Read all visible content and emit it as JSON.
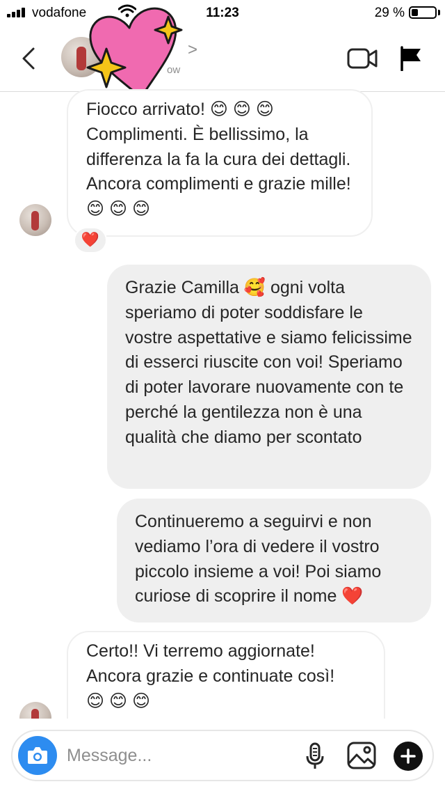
{
  "status_bar": {
    "carrier": "vodafone",
    "time": "11:23",
    "battery_percent": "29 %",
    "battery_level": 0.29
  },
  "header": {
    "name_arrow": ">",
    "subtitle": "ow"
  },
  "messages": [
    {
      "direction": "incoming",
      "text": "Fiocco arrivato! 😊 😊 😊\nComplimenti. È bellissimo, la differenza la fa la cura dei dettagli. Ancora complimenti e grazie mille! 😊 😊 😊",
      "reaction": "❤️"
    },
    {
      "direction": "outgoing",
      "text": "Grazie Camilla 🥰 ogni volta speriamo di poter soddisfare le vostre aspettative e siamo felicissime di esserci riuscite con voi! Speriamo di poter lavorare nuovamente con te perché la gentilezza non è una qualità che diamo per scontato"
    },
    {
      "direction": "outgoing",
      "text": "Continueremo a seguirvi e non vediamo l’ora di vedere il vostro piccolo insieme a voi! Poi siamo curiose di scoprire il nome ❤️"
    },
    {
      "direction": "incoming",
      "text": "Certo!! Vi terremo aggiornate! Ancora grazie e continuate così!\n😊 😊 😊"
    }
  ],
  "composer": {
    "placeholder": "Message..."
  },
  "icons": {
    "back": "chevron-left-icon",
    "video": "video-camera-icon",
    "flag": "flag-icon",
    "camera": "camera-icon",
    "mic": "microphone-icon",
    "gallery": "image-icon",
    "plus": "plus-icon",
    "sticker": "heart-sparkle-sticker"
  },
  "colors": {
    "camera_button": "#2d8cf0",
    "outgoing_bubble": "#efefef",
    "heart_sticker": "#f06ab0",
    "sparkle": "#f5c518"
  }
}
